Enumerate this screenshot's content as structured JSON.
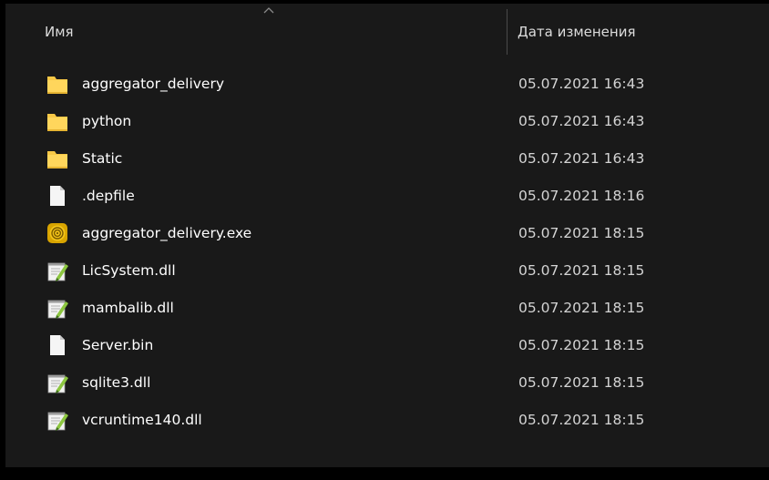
{
  "header": {
    "name_label": "Имя",
    "date_label": "Дата изменения",
    "sort_icon": "chevron-up-icon"
  },
  "files": [
    {
      "name": "aggregator_delivery",
      "modified": "05.07.2021 16:43",
      "icon": "folder-icon"
    },
    {
      "name": "python",
      "modified": "05.07.2021 16:43",
      "icon": "folder-icon"
    },
    {
      "name": "Static",
      "modified": "05.07.2021 16:43",
      "icon": "folder-icon"
    },
    {
      "name": ".depfile",
      "modified": "05.07.2021 18:16",
      "icon": "file-icon"
    },
    {
      "name": "aggregator_delivery.exe",
      "modified": "05.07.2021 18:15",
      "icon": "exe-icon"
    },
    {
      "name": "LicSystem.dll",
      "modified": "05.07.2021 18:15",
      "icon": "dll-icon"
    },
    {
      "name": "mambalib.dll",
      "modified": "05.07.2021 18:15",
      "icon": "dll-icon"
    },
    {
      "name": "Server.bin",
      "modified": "05.07.2021 18:15",
      "icon": "file-icon"
    },
    {
      "name": "sqlite3.dll",
      "modified": "05.07.2021 18:15",
      "icon": "dll-icon"
    },
    {
      "name": "vcruntime140.dll",
      "modified": "05.07.2021 18:15",
      "icon": "dll-icon"
    }
  ],
  "colors": {
    "background": "#191919",
    "folder": "#f8c846",
    "text": "#ffffff"
  }
}
